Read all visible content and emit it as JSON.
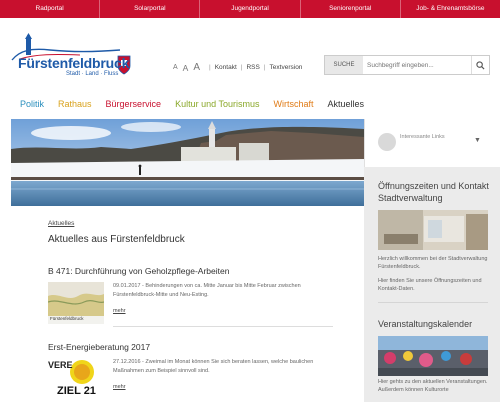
{
  "portal_links": [
    "Radportal",
    "Solarportal",
    "Jugendportal",
    "Seniorenportal",
    "Job- & Ehrenamtsbörse"
  ],
  "logo": {
    "title": "Fürstenfeldbruck",
    "subtitle": "Stadt · Land · Fluss"
  },
  "tools": {
    "font_a1": "A",
    "font_a2": "A",
    "font_a3": "A",
    "contact": "Kontakt",
    "rss": "RSS",
    "textversion": "Textversion",
    "separator": "|"
  },
  "search": {
    "label": "SUCHE",
    "placeholder": "Suchbegriff eingeben..."
  },
  "nav": [
    {
      "label": "Politik",
      "color": "#2a8fbd"
    },
    {
      "label": "Rathaus",
      "color": "#d9a21b"
    },
    {
      "label": "Bürgerservice",
      "color": "#c8102e"
    },
    {
      "label": "Kultur und Tourismus",
      "color": "#8aa829"
    },
    {
      "label": "Wirtschaft",
      "color": "#e07b16"
    },
    {
      "label": "Aktuelles",
      "color": "#333333"
    }
  ],
  "breadcrumb": "Aktuelles",
  "page_title": "Aktuelles aus Fürstenfeldbruck",
  "articles": [
    {
      "title": "B 471: Durchführung von Geholzpflege-Arbeiten",
      "date_text": "09.01.2017 - Behinderungen von ca. Mitte Januar bis Mitte Februar zwischen Fürstenfeldbruck-Mitte und Neu-Esting.",
      "thumb_label": "Fürstenfeldbruck",
      "more": "mehr"
    },
    {
      "title": "Erst-Energieberatung 2017",
      "date_text": "27.12.2016 - Zweimal im Monat können Sie sich beraten lassen, welche baulichen Maßnahmen zum Beispiel sinnvoll sind.",
      "thumb_label_top": "VERE",
      "thumb_label_bottom": "ZIEL 21",
      "more": "mehr"
    }
  ],
  "sidebar": {
    "links_label": "Interessante Links",
    "hours_heading": "Öffnungszeiten und Kontakt Stadtverwaltung",
    "hours_text": "Herzlich willkommen bei der Stadtverwaltung Fürstenfeldbruck.",
    "hours_text2": "Hier finden Sie unsere Öffnungszeiten und Kontakt-Daten.",
    "events_heading": "Veranstaltungskalender",
    "events_text": "Hier gehts zu den aktuellen Veranstaltungen. Außerdem können Kulturorte"
  },
  "colors": {
    "portal_bar": "#c8102e",
    "logo_blue": "#1e5aa8",
    "sidebar_bg": "#ebebeb"
  },
  "icons": [
    "search-icon",
    "chevron-down-icon",
    "links-icon",
    "city-crest-icon"
  ]
}
